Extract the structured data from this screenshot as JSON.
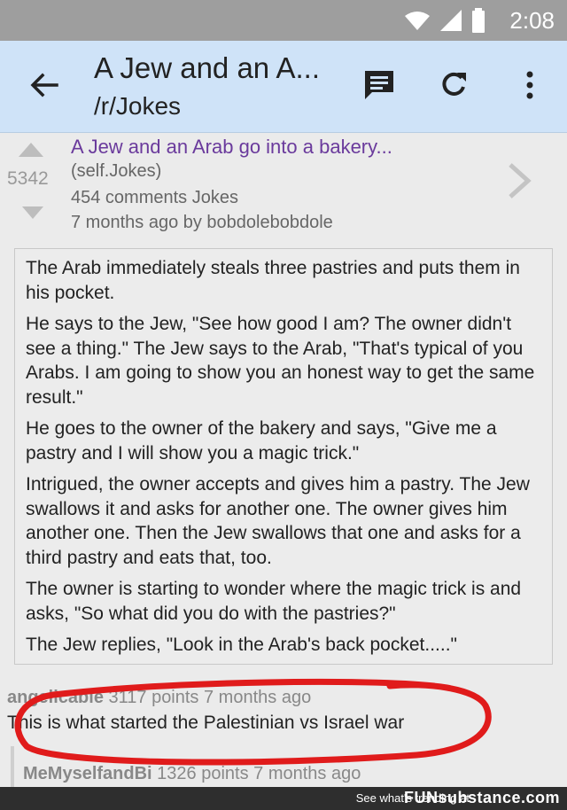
{
  "status_bar": {
    "time": "2:08"
  },
  "app_bar": {
    "title": "A Jew and an A...",
    "subtitle": "/r/Jokes"
  },
  "post": {
    "score": "5342",
    "title": "A Jew and an Arab go into a bakery...",
    "domain": "(self.Jokes)",
    "comments_and_flair": "454 comments  Jokes",
    "age_and_author": "7 months ago by bobdolebobdole",
    "paragraphs": [
      "The Arab immediately steals three pastries and puts them in his pocket.",
      "He says to the Jew, \"See how good I am? The owner didn't see a thing.\" The Jew says to the Arab, \"That's typical of you Arabs. I am going to show you an honest way to get the same result.\"",
      "He goes to the owner of the bakery and says, \"Give me a pastry and I will show you a magic trick.\"",
      "Intrigued, the owner accepts and gives him a pastry. The Jew swallows it and asks for another one. The owner gives him another one. Then the Jew swallows that one and asks for a third pastry and eats that, too.",
      "The owner is starting to wonder where the magic trick is and asks, \"So what did you do with the pastries?\"",
      "The Jew replies, \"Look in the Arab's back pocket.....\""
    ]
  },
  "comment": {
    "author": "angelicable",
    "points": "3117 points",
    "age": "7 months ago",
    "body": "This is what started the Palestinian vs Israel war"
  },
  "reply": {
    "author": "MeMyselfandBi",
    "points": "1326 points",
    "age": "7 months ago"
  },
  "footer": {
    "text": "See what's trending at",
    "brand": "FUNsubstance.com"
  },
  "colors": {
    "app_bar": "#cfe3f8",
    "post_title": "#6a3a9c",
    "annotation": "#e01b1b"
  }
}
